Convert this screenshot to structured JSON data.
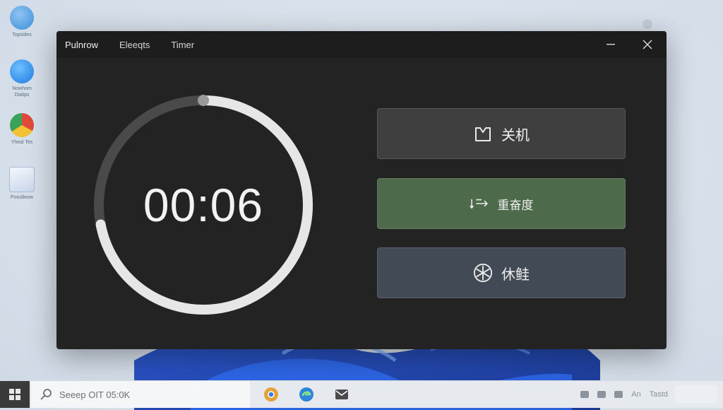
{
  "desktop": {
    "icons": [
      {
        "label": "Topsides",
        "icon": "person-icon",
        "color": "#3a8fd8"
      },
      {
        "label": "Nowhom\nDialips",
        "icon": "edge-icon",
        "color": "#1f7be0"
      },
      {
        "label": "Yheal Tes",
        "icon": "chrome-icon",
        "color": "#3aa35a"
      },
      {
        "label": "Pooslleow",
        "icon": "document-icon",
        "color": "#5a86c8"
      }
    ]
  },
  "window": {
    "tabs": [
      "Pulnrow",
      "Eleeqts",
      "Timer"
    ],
    "minimize_icon": "minimize-icon",
    "close_icon": "close-icon"
  },
  "timer": {
    "display": "00:06",
    "progress": 0.72,
    "track_color": "#4a4a4a",
    "progress_color": "#e6e6e6",
    "knob_color": "#9a9a9a"
  },
  "actions": [
    {
      "label": "关机",
      "icon": "shutdown-box-icon",
      "color": "#3f3f3f"
    },
    {
      "label": "重奋度",
      "icon": "restart-arrow-icon",
      "color": "#4d6a4b"
    },
    {
      "label": "休鲑",
      "icon": "snowflake-icon",
      "color": "#414a55"
    }
  ],
  "taskbar": {
    "search_text": "Seeep OIT 05:0K",
    "apps": [
      {
        "icon": "chrome-icon",
        "color": "#e2a33a"
      },
      {
        "icon": "edge-icon",
        "color": "#2d86d9"
      },
      {
        "icon": "mail-icon",
        "color": "#4b4b4b"
      }
    ],
    "tray_text": [
      "An",
      "Tastd"
    ]
  }
}
